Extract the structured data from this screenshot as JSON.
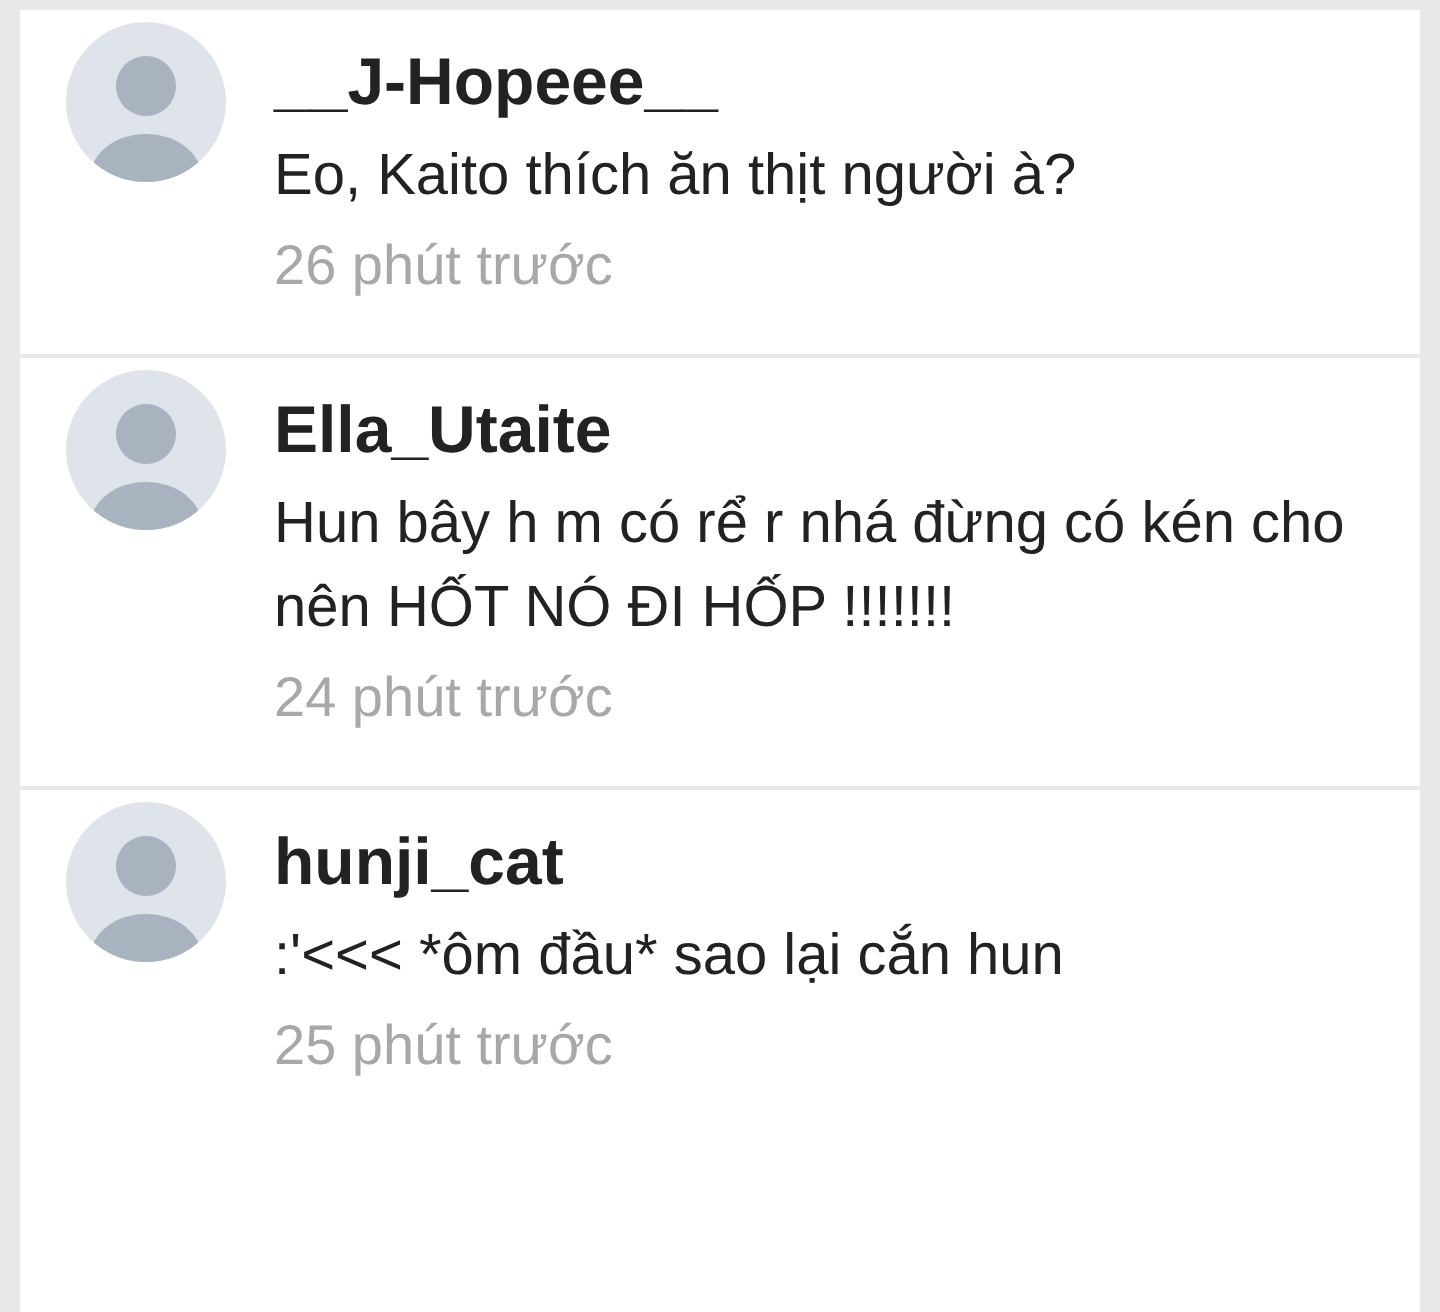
{
  "comments": [
    {
      "author": "__J-Hopeee__",
      "text": "Eo, Kaito thích ăn thịt người à?",
      "time": "26 phút trước"
    },
    {
      "author": "Ella_Utaite",
      "text": "Hun bây h m có rể r nhá đừng có kén cho nên HỐT NÓ ĐI HỐP !!!!!!!",
      "time": "24 phút trước"
    },
    {
      "author": "hunji_cat",
      "text": ":'<<< *ôm đầu* sao lại cắn hun",
      "time": "25 phút trước"
    }
  ]
}
